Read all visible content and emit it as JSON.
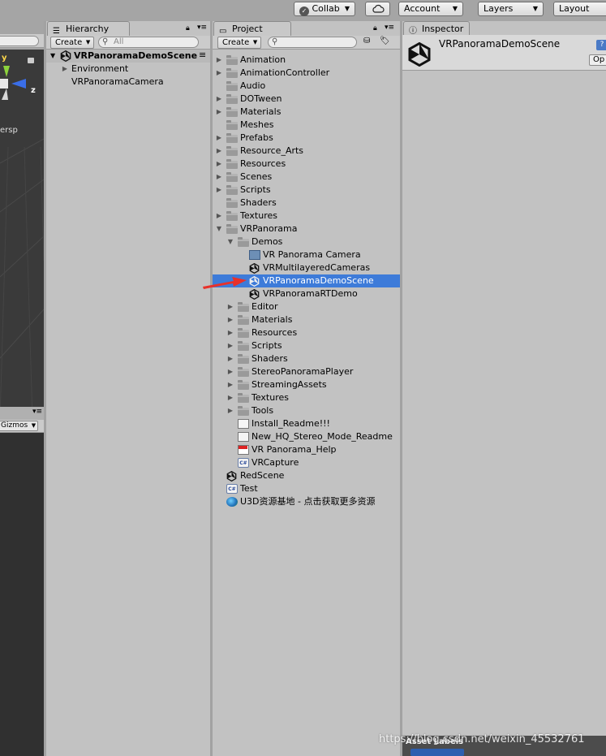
{
  "toolbar": {
    "collab_label": "Collab",
    "account_label": "Account",
    "layers_label": "Layers",
    "layout_label": "Layout"
  },
  "scene_view": {
    "axis_y": "y",
    "axis_z": "z",
    "persp_label": "ersp",
    "gizmos_label": "Gizmos"
  },
  "hierarchy": {
    "tab_label": "Hierarchy",
    "create_label": "Create",
    "search_placeholder": "All",
    "scene_name": "VRPanoramaDemoScene",
    "items": [
      "Environment",
      "VRPanoramaCamera"
    ]
  },
  "project": {
    "tab_label": "Project",
    "create_label": "Create",
    "tree": [
      {
        "label": "Animation",
        "depth": 0,
        "icon": "folder-icon",
        "arrow": "collapsed"
      },
      {
        "label": "AnimationController",
        "depth": 0,
        "icon": "folder-icon",
        "arrow": "collapsed"
      },
      {
        "label": "Audio",
        "depth": 0,
        "icon": "folder-icon",
        "arrow": "none"
      },
      {
        "label": "DOTween",
        "depth": 0,
        "icon": "folder-icon",
        "arrow": "collapsed"
      },
      {
        "label": "Materials",
        "depth": 0,
        "icon": "folder-icon",
        "arrow": "collapsed"
      },
      {
        "label": "Meshes",
        "depth": 0,
        "icon": "folder-icon",
        "arrow": "none"
      },
      {
        "label": "Prefabs",
        "depth": 0,
        "icon": "folder-icon",
        "arrow": "collapsed"
      },
      {
        "label": "Resource_Arts",
        "depth": 0,
        "icon": "folder-icon",
        "arrow": "collapsed"
      },
      {
        "label": "Resources",
        "depth": 0,
        "icon": "folder-icon",
        "arrow": "collapsed"
      },
      {
        "label": "Scenes",
        "depth": 0,
        "icon": "folder-icon",
        "arrow": "collapsed"
      },
      {
        "label": "Scripts",
        "depth": 0,
        "icon": "folder-icon",
        "arrow": "collapsed"
      },
      {
        "label": "Shaders",
        "depth": 0,
        "icon": "folder-icon",
        "arrow": "none"
      },
      {
        "label": "Textures",
        "depth": 0,
        "icon": "folder-icon",
        "arrow": "collapsed"
      },
      {
        "label": "VRPanorama",
        "depth": 0,
        "icon": "folder-icon",
        "arrow": "expanded"
      },
      {
        "label": "Demos",
        "depth": 1,
        "icon": "folder-icon",
        "arrow": "expanded"
      },
      {
        "label": "VR Panorama Camera",
        "depth": 2,
        "icon": "prefab-icon",
        "arrow": "none"
      },
      {
        "label": "VRMultilayeredCameras",
        "depth": 2,
        "icon": "unity-scene-icon",
        "arrow": "none"
      },
      {
        "label": "VRPanoramaDemoScene",
        "depth": 2,
        "icon": "unity-scene-icon",
        "arrow": "none",
        "selected": true
      },
      {
        "label": "VRPanoramaRTDemo",
        "depth": 2,
        "icon": "unity-scene-icon",
        "arrow": "none"
      },
      {
        "label": "Editor",
        "depth": 1,
        "icon": "folder-icon",
        "arrow": "collapsed"
      },
      {
        "label": "Materials",
        "depth": 1,
        "icon": "folder-icon",
        "arrow": "collapsed"
      },
      {
        "label": "Resources",
        "depth": 1,
        "icon": "folder-icon",
        "arrow": "collapsed"
      },
      {
        "label": "Scripts",
        "depth": 1,
        "icon": "folder-icon",
        "arrow": "collapsed"
      },
      {
        "label": "Shaders",
        "depth": 1,
        "icon": "folder-icon",
        "arrow": "collapsed"
      },
      {
        "label": "StereoPanoramaPlayer",
        "depth": 1,
        "icon": "folder-icon",
        "arrow": "collapsed"
      },
      {
        "label": "StreamingAssets",
        "depth": 1,
        "icon": "folder-icon",
        "arrow": "collapsed"
      },
      {
        "label": "Textures",
        "depth": 1,
        "icon": "folder-icon",
        "arrow": "collapsed"
      },
      {
        "label": "Tools",
        "depth": 1,
        "icon": "folder-icon",
        "arrow": "collapsed"
      },
      {
        "label": "Install_Readme!!!",
        "depth": 1,
        "icon": "text-file-icon",
        "arrow": "none"
      },
      {
        "label": "New_HQ_Stereo_Mode_Readme",
        "depth": 1,
        "icon": "text-file-icon",
        "arrow": "none"
      },
      {
        "label": "VR Panorama_Help",
        "depth": 1,
        "icon": "pdf-file-icon",
        "arrow": "none"
      },
      {
        "label": "VRCapture",
        "depth": 1,
        "icon": "csharp-script-icon",
        "arrow": "none"
      },
      {
        "label": "RedScene",
        "depth": 0,
        "icon": "unity-scene-icon",
        "arrow": "none"
      },
      {
        "label": "Test",
        "depth": 0,
        "icon": "csharp-script-icon",
        "arrow": "none"
      },
      {
        "label": "U3D资源基地 - 点击获取更多资源",
        "depth": 0,
        "icon": "globe-icon",
        "arrow": "none"
      }
    ]
  },
  "inspector": {
    "tab_label": "Inspector",
    "asset_name": "VRPanoramaDemoScene",
    "open_label": "Op",
    "help_label": "?",
    "asset_labels": "Asset Labels"
  },
  "watermark": "https://blog.csdn.net/weixin_45532761",
  "colors": {
    "selection": "#3d7bd9",
    "panel": "#c2c2c2",
    "arrow_annotation": "#e8312a"
  }
}
